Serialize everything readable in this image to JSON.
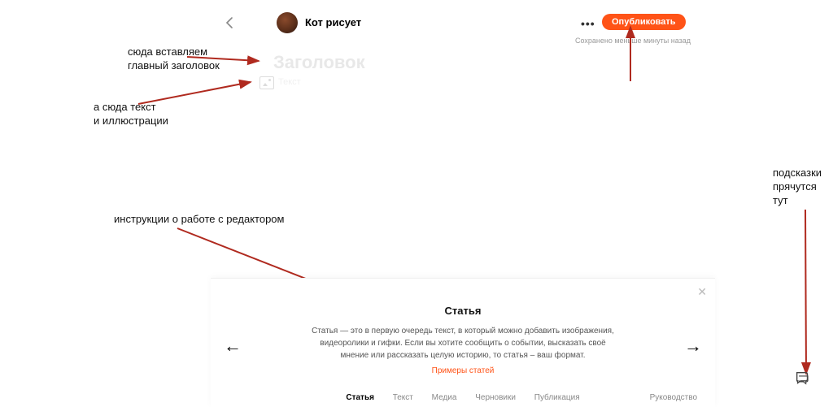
{
  "header": {
    "channel_name": "Кот рисует",
    "publish_label": "Опубликовать",
    "save_status": "Сохранено меньше минуты назад"
  },
  "editor": {
    "title_placeholder": "Заголовок",
    "body_placeholder": "Текст"
  },
  "annotations": {
    "title_hint_l1": "сюда вставляем",
    "title_hint_l2": "главный заголовок",
    "body_hint_l1": "а сюда текст",
    "body_hint_l2": "и иллюстрации",
    "instructions": "инструкции о работе с редактором",
    "tips_l1": "подсказки",
    "tips_l2": "прячутся",
    "tips_l3": "тут"
  },
  "tip": {
    "title": "Статья",
    "description": "Статья — это в первую очередь текст, в который можно добавить изображения, видеоролики и гифки. Если вы хотите сообщить о событии, высказать своё мнение или рассказать целую историю, то статья – ваш формат.",
    "link": "Примеры статей",
    "tabs": [
      "Статья",
      "Текст",
      "Медиа",
      "Черновики",
      "Публикация"
    ],
    "active_tab": 0,
    "guide": "Руководство"
  },
  "colors": {
    "accent": "#ff5317",
    "annotation_arrow": "#b02a1f"
  }
}
